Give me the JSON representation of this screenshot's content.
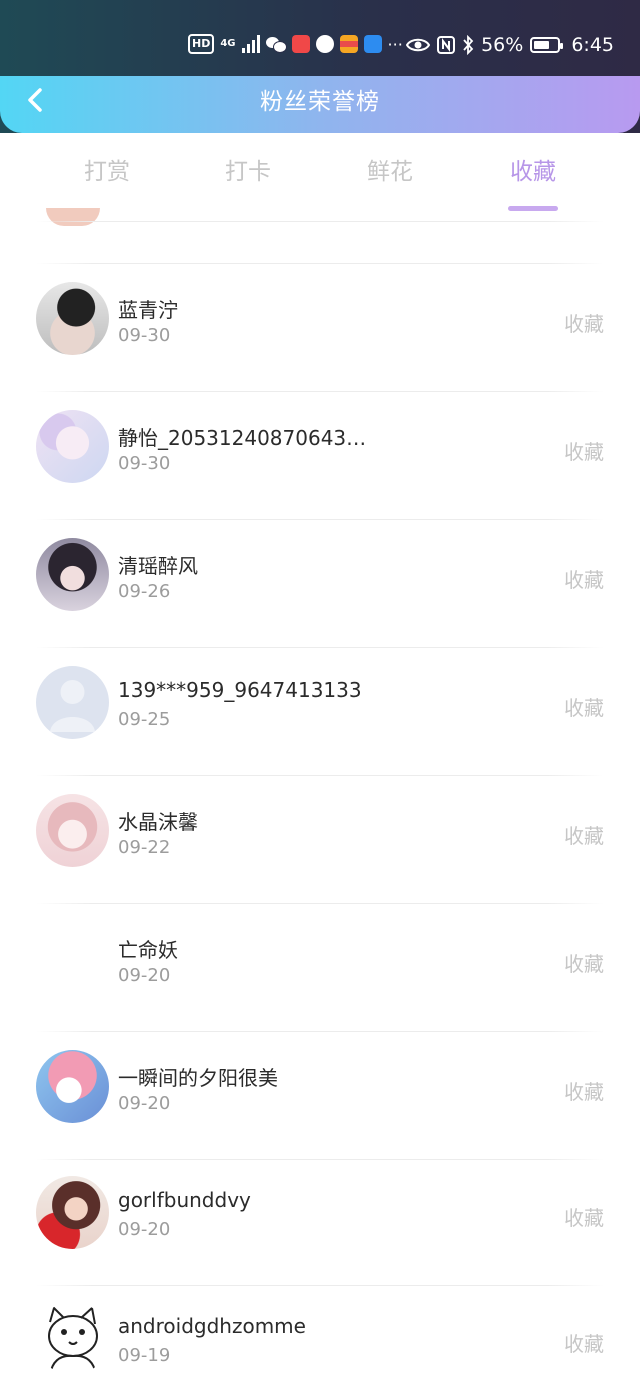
{
  "status_bar": {
    "network": "4G",
    "hd": "HD",
    "battery": "56%",
    "time": "6:45",
    "more": "···"
  },
  "header": {
    "title": "粉丝荣誉榜",
    "back_icon": "chevron-left-icon"
  },
  "tabs": [
    {
      "label": "打赏",
      "active": false
    },
    {
      "label": "打卡",
      "active": false
    },
    {
      "label": "鲜花",
      "active": false
    },
    {
      "label": "收藏",
      "active": true
    }
  ],
  "list": {
    "items": [
      {
        "name": "蓝青泞",
        "date": "09-30",
        "action": "收藏",
        "avatar": "avatar-photo-cap"
      },
      {
        "name": "静怡_20531240870643…",
        "date": "09-30",
        "action": "收藏",
        "avatar": "avatar-anime-pastel"
      },
      {
        "name": "清瑶醉风",
        "date": "09-26",
        "action": "收藏",
        "avatar": "avatar-anime-dark"
      },
      {
        "name": "139***959_9647413133",
        "date": "09-25",
        "action": "收藏",
        "avatar": "avatar-default-user"
      },
      {
        "name": "水晶沫馨",
        "date": "09-22",
        "action": "收藏",
        "avatar": "avatar-anime-pink"
      },
      {
        "name": "亡命妖",
        "date": "09-20",
        "action": "收藏",
        "avatar": "avatar-blank"
      },
      {
        "name": "一瞬间的夕阳很美",
        "date": "09-20",
        "action": "收藏",
        "avatar": "avatar-cartoon-girl"
      },
      {
        "name": "gorlfbunddvy",
        "date": "09-20",
        "action": "收藏",
        "avatar": "avatar-photo-red"
      },
      {
        "name": "androidgdhzomme",
        "date": "09-19",
        "action": "收藏",
        "avatar": "avatar-sketch-cat"
      }
    ]
  },
  "colors": {
    "nav_gradient_start": "#53d6f4",
    "nav_gradient_end": "#b89af0",
    "tab_active": "#b796e8",
    "tab_inactive": "#c6c6c6"
  }
}
